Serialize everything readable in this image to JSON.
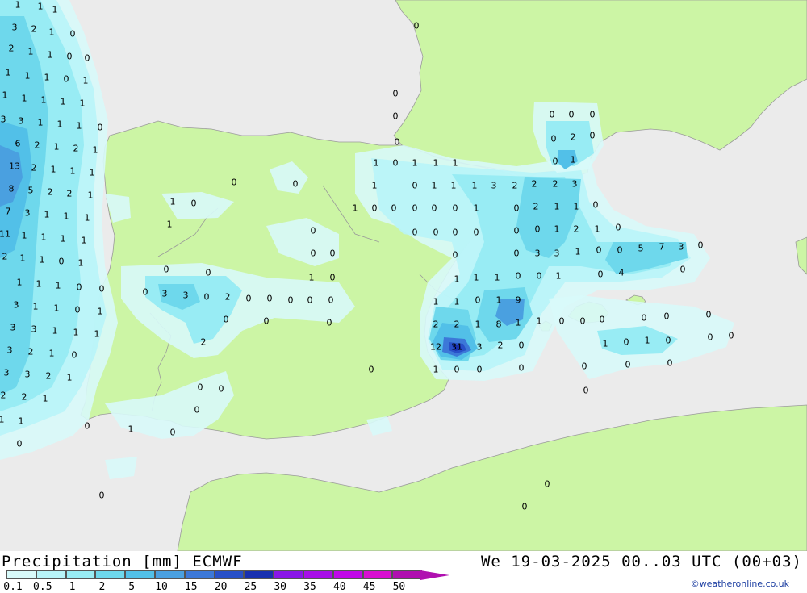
{
  "header": {
    "title": "Precipitation [mm] ECMWF",
    "datetime": "We 19-03-2025 00..03 UTC (00+03)",
    "credit": "©weatheronline.co.uk"
  },
  "colors": {
    "sea": "#ebebeb",
    "land": "#ccf5a5",
    "border": "#9a9a9a"
  },
  "legend": {
    "ticks": [
      "0.1",
      "0.5",
      "1",
      "2",
      "5",
      "10",
      "15",
      "20",
      "25",
      "30",
      "35",
      "40",
      "45",
      "50"
    ],
    "swatches": [
      "#d8fafa",
      "#b8f4f8",
      "#98ecf4",
      "#6ed8ec",
      "#52c0e8",
      "#4aa0e0",
      "#3c78d8",
      "#2850c8",
      "#1830b0",
      "#8a16e8",
      "#a80ee8",
      "#c008e8",
      "#d80ed0",
      "#b010b0"
    ]
  },
  "map": {
    "values": [
      [
        "1",
        22,
        6
      ],
      [
        "1",
        50,
        8
      ],
      [
        "1",
        68,
        12
      ],
      [
        "3",
        18,
        34
      ],
      [
        "2",
        42,
        36
      ],
      [
        "1",
        64,
        40
      ],
      [
        "0",
        90,
        42
      ],
      [
        "2",
        14,
        60
      ],
      [
        "1",
        38,
        64
      ],
      [
        "1",
        62,
        68
      ],
      [
        "0",
        86,
        70
      ],
      [
        "0",
        108,
        72
      ],
      [
        "1",
        10,
        90
      ],
      [
        "1",
        34,
        94
      ],
      [
        "1",
        58,
        96
      ],
      [
        "0",
        82,
        98
      ],
      [
        "1",
        106,
        100
      ],
      [
        "1",
        6,
        118
      ],
      [
        "1",
        30,
        122
      ],
      [
        "1",
        54,
        124
      ],
      [
        "1",
        78,
        126
      ],
      [
        "1",
        102,
        128
      ],
      [
        "3",
        4,
        148
      ],
      [
        "3",
        26,
        150
      ],
      [
        "1",
        50,
        152
      ],
      [
        "1",
        74,
        154
      ],
      [
        "1",
        98,
        156
      ],
      [
        "0",
        124,
        158
      ],
      [
        "6",
        22,
        178
      ],
      [
        "2",
        46,
        180
      ],
      [
        "1",
        70,
        182
      ],
      [
        "2",
        94,
        184
      ],
      [
        "1",
        118,
        186
      ],
      [
        "13",
        18,
        206
      ],
      [
        "2",
        42,
        208
      ],
      [
        "1",
        66,
        210
      ],
      [
        "1",
        90,
        212
      ],
      [
        "1",
        114,
        214
      ],
      [
        "8",
        14,
        234
      ],
      [
        "5",
        38,
        236
      ],
      [
        "2",
        62,
        238
      ],
      [
        "2",
        86,
        240
      ],
      [
        "1",
        112,
        242
      ],
      [
        "7",
        10,
        262
      ],
      [
        "3",
        34,
        264
      ],
      [
        "1",
        58,
        266
      ],
      [
        "1",
        82,
        268
      ],
      [
        "1",
        108,
        270
      ],
      [
        "11",
        6,
        290
      ],
      [
        "1",
        30,
        292
      ],
      [
        "1",
        54,
        294
      ],
      [
        "1",
        78,
        296
      ],
      [
        "1",
        104,
        298
      ],
      [
        "2",
        6,
        318
      ],
      [
        "1",
        28,
        320
      ],
      [
        "1",
        52,
        322
      ],
      [
        "0",
        76,
        324
      ],
      [
        "1",
        100,
        326
      ],
      [
        "1",
        24,
        350
      ],
      [
        "1",
        48,
        352
      ],
      [
        "1",
        72,
        354
      ],
      [
        "0",
        98,
        356
      ],
      [
        "0",
        126,
        358
      ],
      [
        "3",
        20,
        378
      ],
      [
        "1",
        44,
        380
      ],
      [
        "1",
        70,
        382
      ],
      [
        "0",
        96,
        384
      ],
      [
        "1",
        124,
        386
      ],
      [
        "3",
        16,
        406
      ],
      [
        "3",
        42,
        408
      ],
      [
        "1",
        68,
        410
      ],
      [
        "1",
        94,
        412
      ],
      [
        "1",
        120,
        414
      ],
      [
        "3",
        12,
        434
      ],
      [
        "2",
        38,
        436
      ],
      [
        "1",
        64,
        438
      ],
      [
        "0",
        92,
        440
      ],
      [
        "3",
        8,
        462
      ],
      [
        "3",
        34,
        464
      ],
      [
        "2",
        60,
        466
      ],
      [
        "1",
        86,
        468
      ],
      [
        "2",
        4,
        490
      ],
      [
        "2",
        30,
        492
      ],
      [
        "1",
        56,
        494
      ],
      [
        "1",
        2,
        520
      ],
      [
        "1",
        26,
        522
      ],
      [
        "0",
        24,
        550
      ],
      [
        "0",
        108,
        528
      ],
      [
        "1",
        162,
        532
      ],
      [
        "0",
        214,
        536
      ],
      [
        "0",
        126,
        614
      ],
      [
        "0",
        490,
        116
      ],
      [
        "0",
        490,
        144
      ],
      [
        "0",
        492,
        176
      ],
      [
        "0",
        516,
        32
      ],
      [
        "1",
        466,
        202
      ],
      [
        "0",
        490,
        202
      ],
      [
        "1",
        514,
        202
      ],
      [
        "1",
        540,
        202
      ],
      [
        "1",
        564,
        202
      ],
      [
        "1",
        464,
        230
      ],
      [
        "0",
        514,
        230
      ],
      [
        "1",
        538,
        230
      ],
      [
        "1",
        562,
        230
      ],
      [
        "1",
        588,
        230
      ],
      [
        "3",
        612,
        230
      ],
      [
        "2",
        638,
        230
      ],
      [
        "2",
        662,
        228
      ],
      [
        "2",
        688,
        228
      ],
      [
        "3",
        712,
        228
      ],
      [
        "1",
        440,
        258
      ],
      [
        "0",
        464,
        258
      ],
      [
        "0",
        488,
        258
      ],
      [
        "0",
        514,
        258
      ],
      [
        "0",
        538,
        258
      ],
      [
        "0",
        564,
        258
      ],
      [
        "1",
        590,
        258
      ],
      [
        "0",
        640,
        258
      ],
      [
        "2",
        664,
        256
      ],
      [
        "1",
        690,
        256
      ],
      [
        "1",
        714,
        256
      ],
      [
        "0",
        738,
        254
      ],
      [
        "0",
        514,
        288
      ],
      [
        "0",
        540,
        288
      ],
      [
        "0",
        564,
        288
      ],
      [
        "0",
        590,
        288
      ],
      [
        "0",
        640,
        286
      ],
      [
        "0",
        666,
        284
      ],
      [
        "1",
        690,
        284
      ],
      [
        "2",
        714,
        284
      ],
      [
        "1",
        740,
        284
      ],
      [
        "0",
        766,
        282
      ],
      [
        "0",
        564,
        316
      ],
      [
        "0",
        640,
        314
      ],
      [
        "3",
        666,
        314
      ],
      [
        "3",
        690,
        314
      ],
      [
        "1",
        716,
        312
      ],
      [
        "0",
        742,
        310
      ],
      [
        "0",
        768,
        310
      ],
      [
        "5",
        794,
        308
      ],
      [
        "7",
        820,
        306
      ],
      [
        "3",
        844,
        306
      ],
      [
        "0",
        868,
        304
      ],
      [
        "1",
        566,
        346
      ],
      [
        "1",
        590,
        344
      ],
      [
        "1",
        616,
        344
      ],
      [
        "0",
        642,
        342
      ],
      [
        "0",
        668,
        342
      ],
      [
        "1",
        692,
        342
      ],
      [
        "0",
        744,
        340
      ],
      [
        "4",
        770,
        338
      ],
      [
        "0",
        846,
        334
      ],
      [
        "1",
        540,
        374
      ],
      [
        "1",
        566,
        374
      ],
      [
        "0",
        592,
        372
      ],
      [
        "1",
        618,
        372
      ],
      [
        "9",
        642,
        372
      ],
      [
        "2",
        540,
        402
      ],
      [
        "2",
        566,
        402
      ],
      [
        "1",
        592,
        402
      ],
      [
        "8",
        618,
        402
      ],
      [
        "1",
        642,
        400
      ],
      [
        "1",
        668,
        398
      ],
      [
        "0",
        696,
        398
      ],
      [
        "0",
        722,
        398
      ],
      [
        "0",
        746,
        396
      ],
      [
        "0",
        798,
        394
      ],
      [
        "0",
        826,
        392
      ],
      [
        "0",
        878,
        390
      ],
      [
        "12",
        540,
        430
      ],
      [
        "31",
        566,
        430
      ],
      [
        "3",
        594,
        430
      ],
      [
        "2",
        620,
        428
      ],
      [
        "0",
        646,
        428
      ],
      [
        "1",
        750,
        426
      ],
      [
        "0",
        776,
        424
      ],
      [
        "1",
        802,
        422
      ],
      [
        "0",
        828,
        422
      ],
      [
        "0",
        880,
        418
      ],
      [
        "0",
        906,
        416
      ],
      [
        "1",
        540,
        458
      ],
      [
        "0",
        566,
        458
      ],
      [
        "0",
        594,
        458
      ],
      [
        "0",
        646,
        456
      ],
      [
        "0",
        724,
        454
      ],
      [
        "0",
        778,
        452
      ],
      [
        "0",
        830,
        450
      ],
      [
        "0",
        726,
        484
      ],
      [
        "0",
        684,
        142
      ],
      [
        "0",
        708,
        142
      ],
      [
        "0",
        734,
        142
      ],
      [
        "0",
        686,
        172
      ],
      [
        "2",
        710,
        170
      ],
      [
        "0",
        734,
        168
      ],
      [
        "0",
        688,
        200
      ],
      [
        "1",
        710,
        198
      ],
      [
        "0",
        290,
        226
      ],
      [
        "0",
        366,
        228
      ],
      [
        "1",
        214,
        250
      ],
      [
        "0",
        240,
        252
      ],
      [
        "1",
        210,
        278
      ],
      [
        "0",
        388,
        286
      ],
      [
        "0",
        388,
        314
      ],
      [
        "0",
        412,
        314
      ],
      [
        "1",
        386,
        344
      ],
      [
        "0",
        412,
        344
      ],
      [
        "0",
        206,
        334
      ],
      [
        "0",
        258,
        338
      ],
      [
        "0",
        180,
        362
      ],
      [
        "3",
        204,
        364
      ],
      [
        "3",
        230,
        366
      ],
      [
        "0",
        256,
        368
      ],
      [
        "2",
        282,
        368
      ],
      [
        "0",
        308,
        370
      ],
      [
        "0",
        334,
        370
      ],
      [
        "0",
        360,
        372
      ],
      [
        "0",
        384,
        372
      ],
      [
        "0",
        410,
        372
      ],
      [
        "0",
        280,
        396
      ],
      [
        "0",
        330,
        398
      ],
      [
        "0",
        408,
        400
      ],
      [
        "2",
        252,
        424
      ],
      [
        "0",
        460,
        458
      ],
      [
        "0",
        248,
        480
      ],
      [
        "0",
        274,
        482
      ],
      [
        "0",
        244,
        508
      ],
      [
        "0",
        678,
        600
      ],
      [
        "0",
        650,
        628
      ]
    ]
  }
}
